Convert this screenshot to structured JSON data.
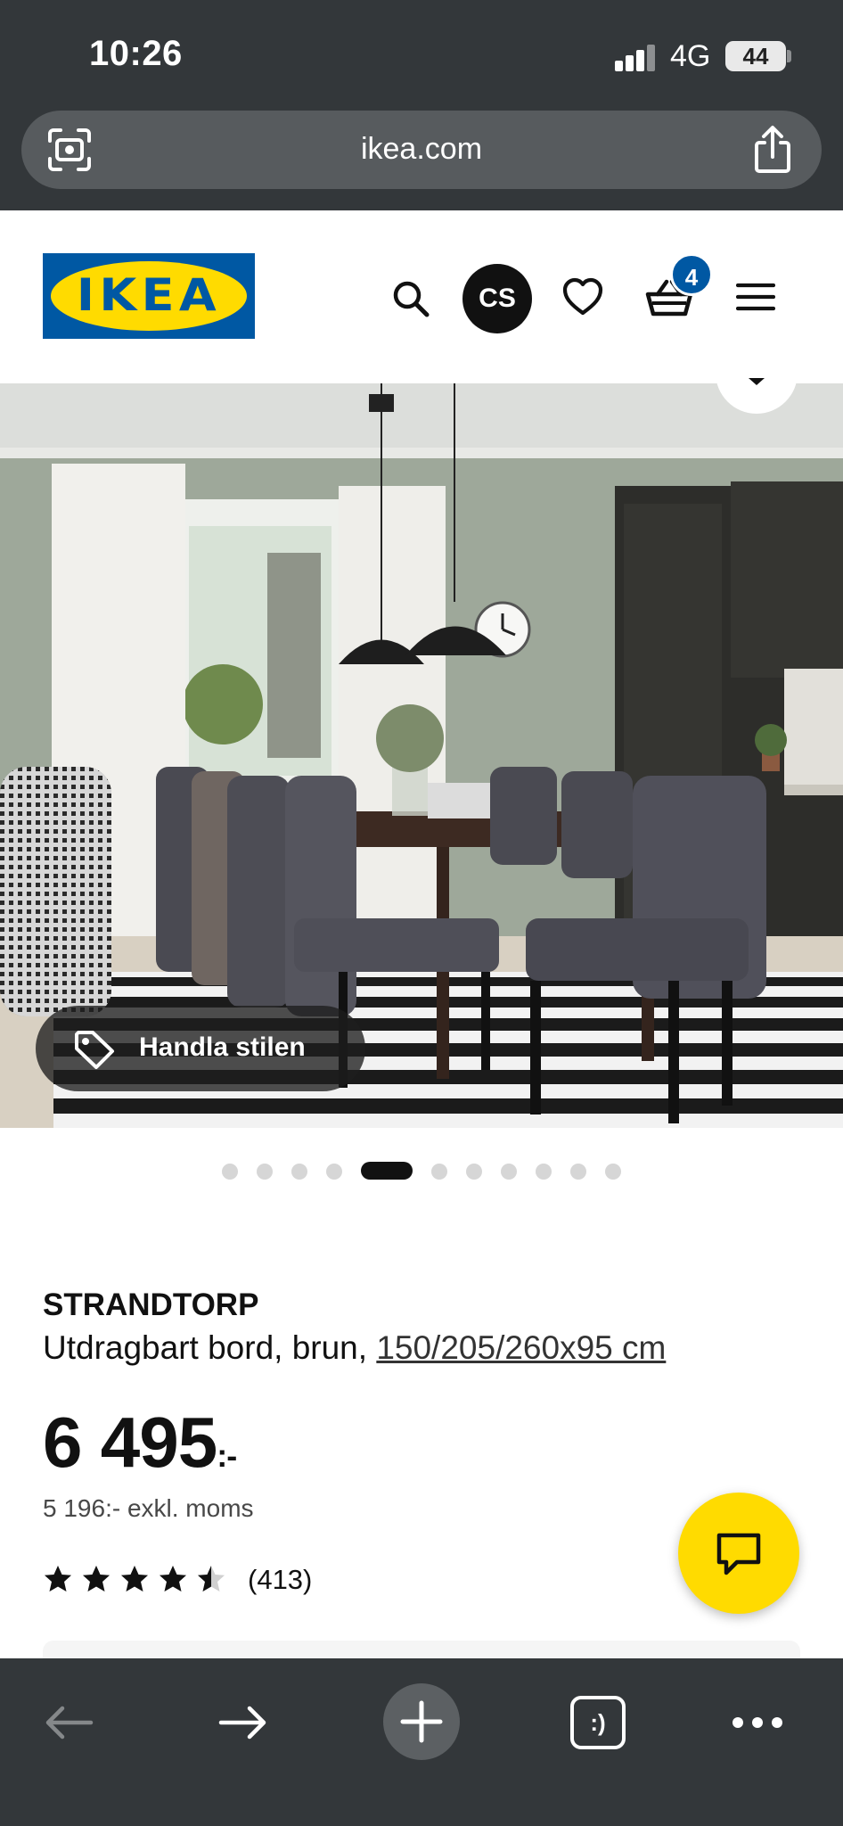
{
  "status_bar": {
    "time": "10:26",
    "network": "4G",
    "battery": "44"
  },
  "browser": {
    "url": "ikea.com"
  },
  "header": {
    "logo_text": "IKEA",
    "avatar_initials": "CS",
    "cart_count": "4"
  },
  "hero": {
    "shop_style_label": "Handla stilen",
    "carousel": {
      "count": 11,
      "active_index": 4
    }
  },
  "product": {
    "name": "STRANDTORP",
    "description": "Utdragbart bord, brun, ",
    "dimensions": "150/205/260x95 cm",
    "price": "6 495",
    "price_suffix": ":-",
    "price_excl_vat": "5 196:- exkl. moms",
    "rating_value": 4.5,
    "rating_max": 5,
    "review_count": "(413)"
  },
  "colors": {
    "ikea_blue": "#0058a3",
    "ikea_yellow": "#ffdb00",
    "browser_chrome": "#33373a"
  },
  "icons": [
    "lens-icon",
    "share-icon",
    "search-icon",
    "heart-icon",
    "basket-icon",
    "menu-icon",
    "tag-icon",
    "chat-icon",
    "back-icon",
    "forward-icon",
    "plus-icon",
    "more-icon"
  ]
}
